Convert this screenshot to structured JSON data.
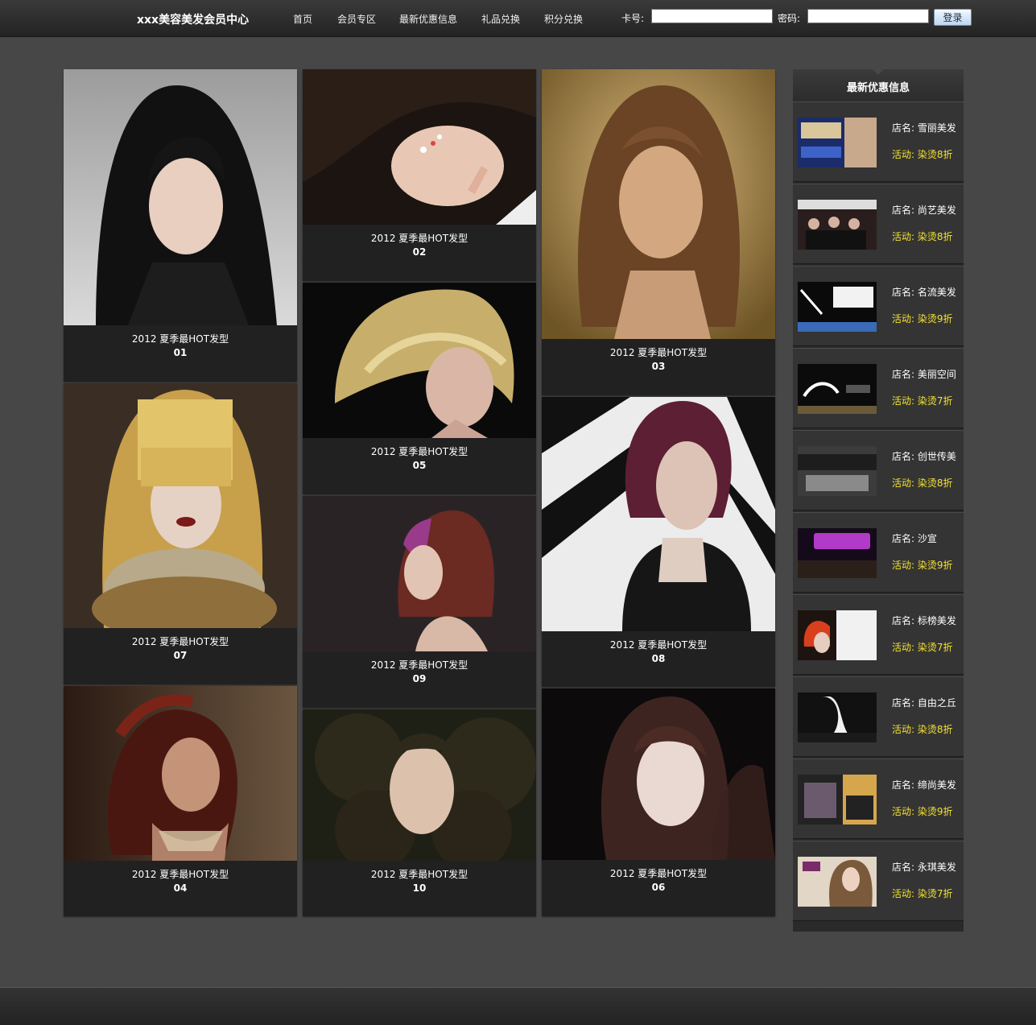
{
  "header": {
    "site_title": "xxx美容美发会员中心",
    "nav": [
      "首页",
      "会员专区",
      "最新优惠信息",
      "礼品兑换",
      "积分兑换"
    ],
    "login": {
      "card_label": "卡号:",
      "password_label": "密码:",
      "login_button": "登录",
      "card_value": "",
      "password_value": ""
    }
  },
  "gallery": [
    {
      "caption": "2012 夏季最HOT发型",
      "number": "01"
    },
    {
      "caption": "2012 夏季最HOT发型",
      "number": "02"
    },
    {
      "caption": "2012 夏季最HOT发型",
      "number": "03"
    },
    {
      "caption": "2012 夏季最HOT发型",
      "number": "07"
    },
    {
      "caption": "2012 夏季最HOT发型",
      "number": "05"
    },
    {
      "caption": "2012 夏季最HOT发型",
      "number": "08"
    },
    {
      "caption": "2012 夏季最HOT发型",
      "number": "09"
    },
    {
      "caption": "2012 夏季最HOT发型",
      "number": "04"
    },
    {
      "caption": "2012 夏季最HOT发型",
      "number": "10"
    },
    {
      "caption": "2012 夏季最HOT发型",
      "number": "06"
    }
  ],
  "sidebar": {
    "title": "最新优惠信息",
    "promos": [
      {
        "store": "店名: 雪丽美发",
        "deal": "活动: 染烫8折"
      },
      {
        "store": "店名: 尚艺美发",
        "deal": "活动: 染烫8折"
      },
      {
        "store": "店名: 名流美发",
        "deal": "活动: 染烫9折"
      },
      {
        "store": "店名: 美丽空间",
        "deal": "活动: 染烫7折"
      },
      {
        "store": "店名: 创世传美",
        "deal": "活动: 染烫8折"
      },
      {
        "store": "店名: 沙宣",
        "deal": "活动: 染烫9折"
      },
      {
        "store": "店名: 标榜美发",
        "deal": "活动: 染烫7折"
      },
      {
        "store": "店名: 自由之丘",
        "deal": "活动: 染烫8折"
      },
      {
        "store": "店名: 缔尚美发",
        "deal": "活动: 染烫9折"
      },
      {
        "store": "店名: 永琪美发",
        "deal": "活动: 染烫7折"
      }
    ]
  },
  "colors": {
    "page_bg": "#474747",
    "card_bg": "#212121",
    "deal_text": "#f3e233"
  }
}
